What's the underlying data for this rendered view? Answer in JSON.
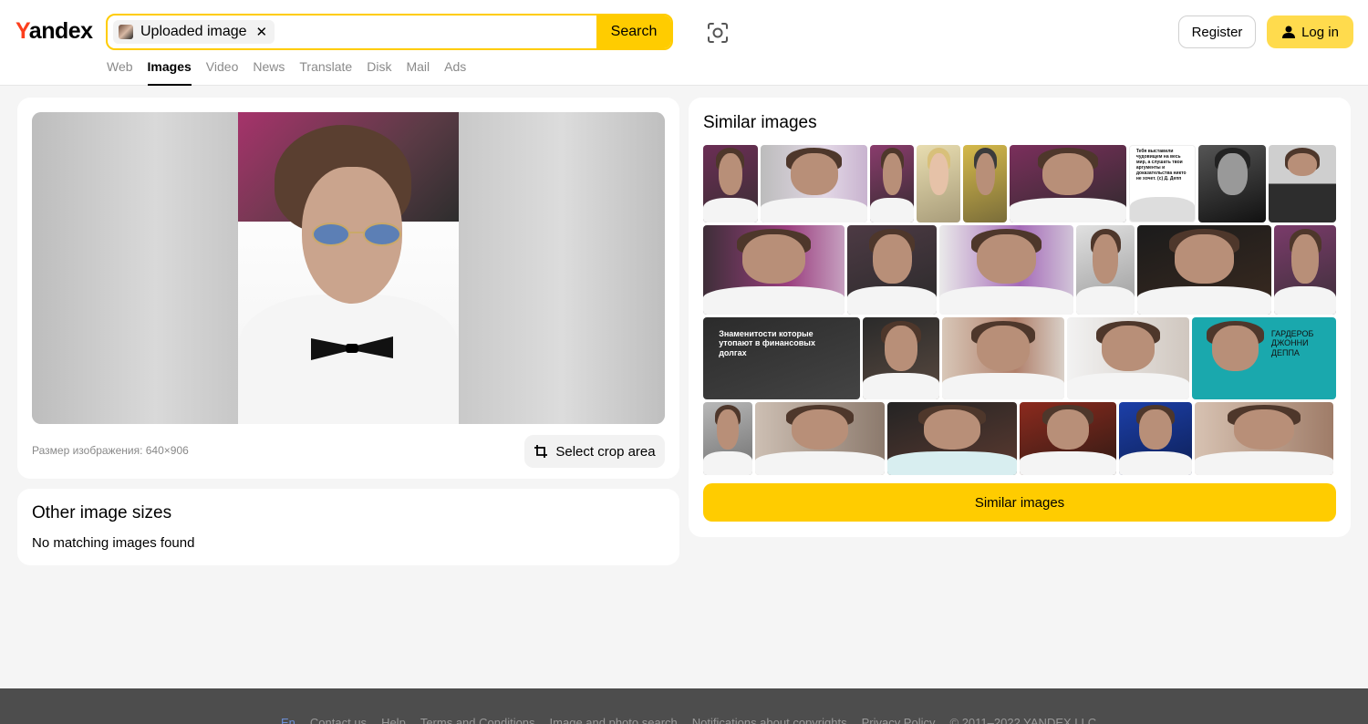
{
  "header": {
    "logo": {
      "first": "Y",
      "rest": "andex"
    },
    "search": {
      "chip_label": "Uploaded image",
      "chip_close": "✕",
      "button": "Search"
    },
    "nav": [
      "Web",
      "Images",
      "Video",
      "News",
      "Translate",
      "Disk",
      "Mail",
      "Ads"
    ],
    "nav_active": "Images",
    "register": "Register",
    "login": "Log in"
  },
  "main": {
    "size_label": "Размер изображения: 640×906",
    "crop_button": "Select crop area"
  },
  "other_sizes": {
    "title": "Other image sizes",
    "message": "No matching images found"
  },
  "similar": {
    "title": "Similar images",
    "button": "Similar images",
    "tile_texts": {
      "quote": "Тебя выставили чудовищем на весь мир, а слушать твои аргументы и доказательства никто не хочет. (c) Д. Депп",
      "debt": "Знаменитости которые утопают в финансовых долгах",
      "wardrobe": "ГАРДЕРОБ ДЖОННИ ДЕППА"
    }
  },
  "footer": {
    "links": [
      "En",
      "Contact us",
      "Help",
      "Terms and Conditions",
      "Image and photo search",
      "Notifications about copyrights",
      "Privacy Policy",
      "© 2011–2022 YANDEX LLC"
    ]
  },
  "colors": {
    "accent": "#ffcc00",
    "brand_red": "#fc3f1d",
    "login": "#ffdb4d"
  }
}
